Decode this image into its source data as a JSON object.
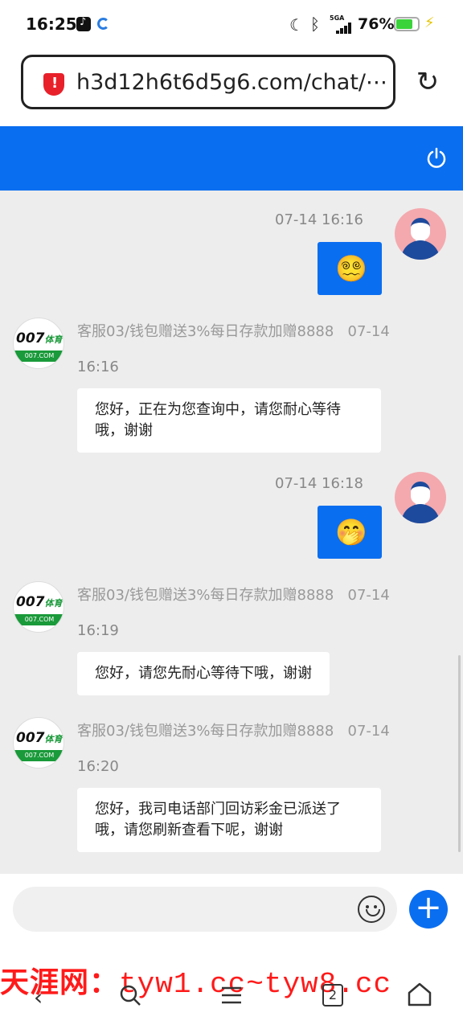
{
  "status": {
    "time": "16:25",
    "network": "5GA",
    "battery": "76%"
  },
  "browser": {
    "url": "h3d12h6t6d5g6.com/chat/⋯"
  },
  "messages": [
    {
      "side": "user",
      "time": "07-14 16:16",
      "emoji": "😵‍💫"
    },
    {
      "side": "agent",
      "name": "客服03/钱包赠送3%每日存款加赠8888",
      "date": "07-14",
      "time": "16:16",
      "text": "您好，正在为您查询中，请您耐心等待哦，谢谢"
    },
    {
      "side": "user",
      "time": "07-14 16:18",
      "emoji": "🤭"
    },
    {
      "side": "agent",
      "name": "客服03/钱包赠送3%每日存款加赠8888",
      "date": "07-14",
      "time": "16:19",
      "text": "您好，请您先耐心等待下哦，谢谢"
    },
    {
      "side": "agent",
      "name": "客服03/钱包赠送3%每日存款加赠8888",
      "date": "07-14",
      "time": "16:20",
      "text": "您好，我司电话部门回访彩金已派送了哦，请您刷新查看下呢，谢谢"
    }
  ],
  "agent_logo": {
    "brand": "007",
    "brand_suffix": "体育",
    "band": "007.COM"
  },
  "input": {
    "placeholder": ""
  },
  "nav": {
    "tabs_count": "2"
  },
  "watermark": {
    "prefix": "天涯网：",
    "sites": "tyw1.cc~tyw8.cc"
  },
  "colors": {
    "accent": "#0a6ef0",
    "background": "#ededed"
  }
}
